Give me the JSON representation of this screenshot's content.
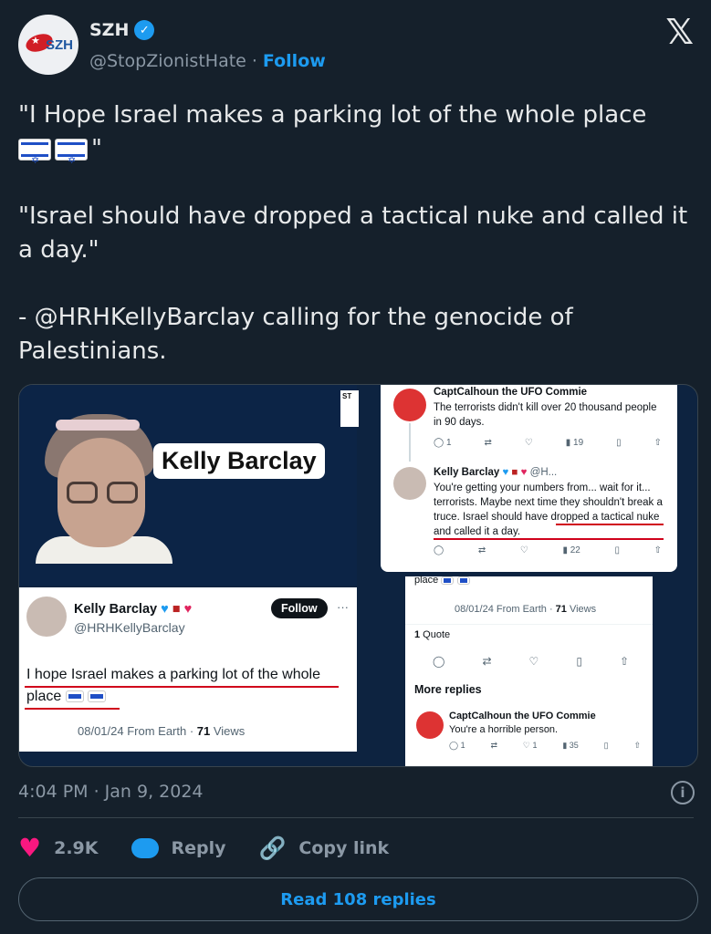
{
  "account": {
    "display_name": "SZH",
    "handle": "@StopZionistHate",
    "separator": "·",
    "follow_label": "Follow",
    "avatar_text": "SZH"
  },
  "platform_logo": "𝕏",
  "tweet": {
    "line1": "\"I Hope Israel makes a parking lot of the whole place",
    "line1_end": "\"",
    "line2": "\"Israel should have dropped a tactical nuke and called it a day.\"",
    "line3": " - @HRHKellyBarclay calling for the genocide of Palestinians."
  },
  "media": {
    "name_tag": "Kelly Barclay",
    "corner_text": "ST",
    "top_right": {
      "reply1_name": "CaptCalhoun the UFO Commie",
      "reply1_body": "The terrorists didn't kill over 20 thousand people in 90 days.",
      "reply1_stats": [
        "1",
        "",
        "",
        "19",
        "",
        ""
      ],
      "reply2_name": "Kelly Barclay",
      "reply2_handle": "@H...",
      "reply2_body": "You're getting your numbers from... wait for it... terrorists. Maybe next time they shouldn't break a truce. Israel should have dropped a tactical nuke and called it a day.",
      "reply2_stats": [
        "",
        "",
        "",
        "22",
        "",
        ""
      ]
    },
    "bottom_left": {
      "name": "Kelly Barclay",
      "handle": "@HRHKellyBarclay",
      "follow_label": "Follow",
      "more": "···",
      "body": "I hope Israel makes a parking lot of the whole place",
      "meta": "08/01/24 From Earth · ",
      "views": "71",
      "views_label": " Views"
    },
    "bottom_right": {
      "top_text": "place",
      "meta": "08/01/24 From Earth · ",
      "views": "71",
      "views_label": " Views",
      "quote_count": "1",
      "quote_label": " Quote",
      "more_replies": "More replies",
      "reply_name": "CaptCalhoun the UFO Commie",
      "reply_body": "You're a horrible person.",
      "reply_stats": [
        "1",
        "",
        "1",
        "35",
        "",
        ""
      ]
    }
  },
  "footer": {
    "timestamp": "4:04 PM · Jan 9, 2024",
    "likes": "2.9K",
    "reply_label": "Reply",
    "copy_label": "Copy link",
    "read_replies": "Read 108 replies"
  },
  "colors": {
    "background": "#15202b",
    "accent": "#1d9bf0",
    "like": "#f91880",
    "underline": "#d0021b"
  }
}
